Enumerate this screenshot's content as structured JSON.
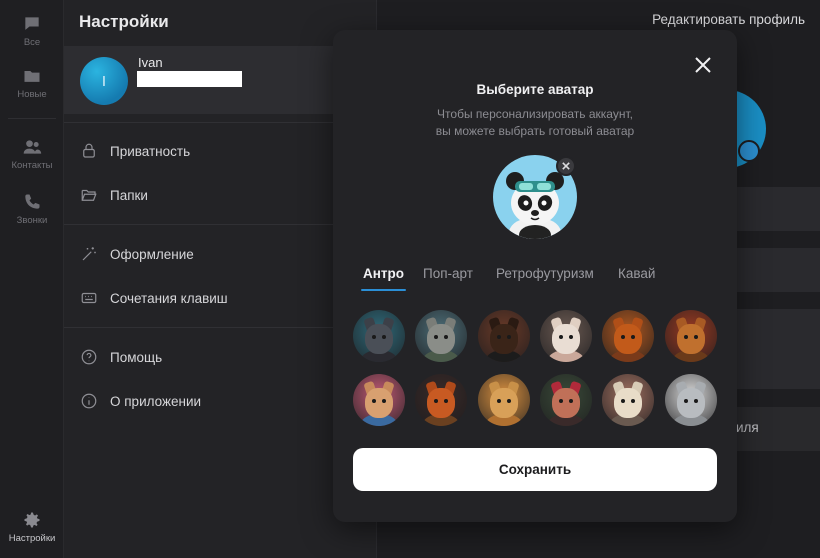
{
  "rail": {
    "items": [
      {
        "label": "Все",
        "icon": "chat-icon"
      },
      {
        "label": "Новые",
        "icon": "folder-icon"
      },
      {
        "label": "Контакты",
        "icon": "contacts-icon"
      },
      {
        "label": "Звонки",
        "icon": "phone-icon"
      }
    ],
    "settings": {
      "label": "Настройки",
      "icon": "gear-icon"
    }
  },
  "settings": {
    "title": "Настройки",
    "profile": {
      "name": "Ivan",
      "initial": "I"
    },
    "menu": [
      {
        "label": "Приватность",
        "icon": "lock-icon"
      },
      {
        "label": "Папки",
        "icon": "folder-open-icon"
      },
      {
        "label": "Оформление",
        "icon": "magic-wand-icon"
      },
      {
        "label": "Сочетания клавиш",
        "icon": "keyboard-icon"
      },
      {
        "label": "Помощь",
        "icon": "help-icon"
      },
      {
        "label": "О приложении",
        "icon": "info-icon"
      }
    ]
  },
  "right": {
    "title": "Редактировать профиль",
    "partial_button_text": "иля"
  },
  "modal": {
    "title": "Выберите аватар",
    "subtitle_line1": "Чтобы персонализировать аккаунт,",
    "subtitle_line2": "вы можете выбрать готовый аватар",
    "tabs": [
      "Антро",
      "Поп-арт",
      "Ретрофутуризм",
      "Кавай"
    ],
    "active_tab": "Антро",
    "avatars": [
      {
        "name": "wolf-hat-avatar",
        "bg": "#2f6a7a",
        "fur": "#4a4f57",
        "body": "#2a2a30",
        "ear": "#3c4048"
      },
      {
        "name": "hippo-avatar",
        "bg": "#4d6e78",
        "fur": "#8a8d88",
        "body": "#4a5a4a",
        "ear": "#7a7d78"
      },
      {
        "name": "doberman-avatar",
        "bg": "#6a3a28",
        "fur": "#3a2418",
        "body": "#1c1c1c",
        "ear": "#2a1a12"
      },
      {
        "name": "white-cat-avatar",
        "bg": "#6b5a52",
        "fur": "#e9ddd3",
        "body": "#caa89a",
        "ear": "#e0cfc2"
      },
      {
        "name": "red-fox-avatar",
        "bg": "#b05820",
        "fur": "#c25a1a",
        "body": "#7a3a1a",
        "ear": "#b04f18"
      },
      {
        "name": "lynx-avatar",
        "bg": "#9a3a22",
        "fur": "#c0702e",
        "body": "#6a3a1a",
        "ear": "#a85a24"
      },
      {
        "name": "hamster-avatar",
        "bg": "#c05a74",
        "fur": "#d8a070",
        "body": "#3a6aa0",
        "ear": "#c88a5c"
      },
      {
        "name": "fox-avatar",
        "bg": "#3a2a28",
        "fur": "#c85a22",
        "body": "#6a4020",
        "ear": "#b04a1a"
      },
      {
        "name": "lioness-avatar",
        "bg": "#d89040",
        "fur": "#d8a058",
        "body": "#b07030",
        "ear": "#c89048"
      },
      {
        "name": "red-hair-avatar",
        "bg": "#3a4a38",
        "fur": "#c07058",
        "body": "#3a2a2a",
        "ear": "#b02a3a"
      },
      {
        "name": "sheep-avatar",
        "bg": "#a07060",
        "fur": "#e8dcc8",
        "body": "#6a5a50",
        "ear": "#d8cbb6"
      },
      {
        "name": "snow-leopard-avatar",
        "bg": "#d8d8d8",
        "fur": "#b8bcc0",
        "body": "#8a8e92",
        "ear": "#a8acb0"
      }
    ],
    "save_label": "Сохранить"
  },
  "colors": {
    "accent": "#2b8fd6",
    "preview_bg": "#8ad2ee"
  }
}
